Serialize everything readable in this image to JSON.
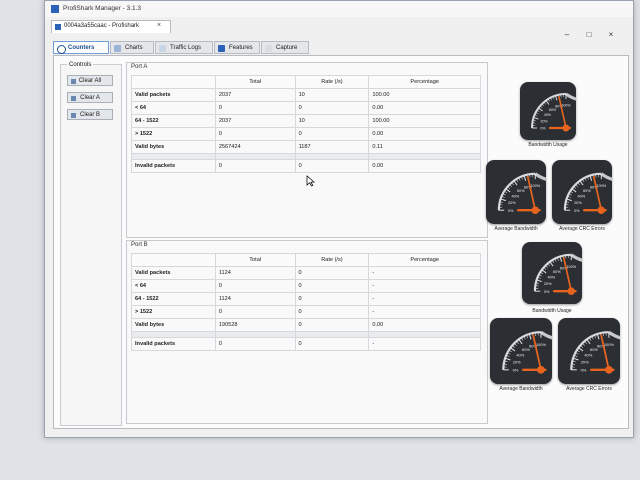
{
  "window": {
    "title": "ProfiShark Manager - 3.1.3",
    "document_tab": "0004a3a55caac - Profishark"
  },
  "tabs": [
    {
      "label": "Counters",
      "active": true
    },
    {
      "label": "Charts",
      "active": false
    },
    {
      "label": "Traffic Logs",
      "active": false
    },
    {
      "label": "Features",
      "active": false
    },
    {
      "label": "Capture",
      "active": false
    }
  ],
  "controls": {
    "title": "Controls",
    "buttons": [
      "Clear All",
      "Clear A",
      "Clear B"
    ]
  },
  "columns": [
    "Total",
    "Rate (/s)",
    "Percentage"
  ],
  "port_a": {
    "title": "Port A",
    "rows": [
      {
        "label": "Valid packets",
        "total": "2037",
        "rate": "10",
        "pct": "100.00"
      },
      {
        "label": "< 64",
        "total": "0",
        "rate": "0",
        "pct": "0.00"
      },
      {
        "label": "64 - 1522",
        "total": "2037",
        "rate": "10",
        "pct": "100.00"
      },
      {
        "label": "> 1522",
        "total": "0",
        "rate": "0",
        "pct": "0.00"
      },
      {
        "label": "Valid bytes",
        "total": "2567424",
        "rate": "1187",
        "pct": "0.11"
      }
    ],
    "invalid": {
      "label": "Invalid packets",
      "total": "0",
      "rate": "0",
      "pct": "0.00"
    }
  },
  "port_b": {
    "title": "Port B",
    "rows": [
      {
        "label": "Valid packets",
        "total": "1124",
        "rate": "0",
        "pct": "-"
      },
      {
        "label": "< 64",
        "total": "0",
        "rate": "0",
        "pct": "-"
      },
      {
        "label": "64 - 1522",
        "total": "1124",
        "rate": "0",
        "pct": "-"
      },
      {
        "label": "> 1522",
        "total": "0",
        "rate": "0",
        "pct": "-"
      },
      {
        "label": "Valid bytes",
        "total": "190528",
        "rate": "0",
        "pct": "0.00"
      }
    ],
    "invalid": {
      "label": "Invalid packets",
      "total": "0",
      "rate": "0",
      "pct": "-"
    }
  },
  "gauges": {
    "a": [
      {
        "label": "Bandwidth Usage",
        "level": 0.86
      },
      {
        "label": "Average Bandwidth",
        "level": 0.86
      },
      {
        "label": "Average CRC Errors",
        "level": 0.86
      }
    ],
    "b": [
      {
        "label": "Bandwidth Usage",
        "level": 0.86
      },
      {
        "label": "Average Bandwidth",
        "level": 0.86
      },
      {
        "label": "Average CRC Errors",
        "level": 0.86
      }
    ],
    "scale_labels": [
      "0%",
      "20%",
      "40%",
      "60%",
      "80%",
      "100%"
    ]
  },
  "colors": {
    "accent": "#e8641e",
    "tab_active": "#1d4f91",
    "gauge_bg": "#2b2f34"
  },
  "icons": {
    "app": "profishark-logo",
    "close": "close-icon"
  }
}
